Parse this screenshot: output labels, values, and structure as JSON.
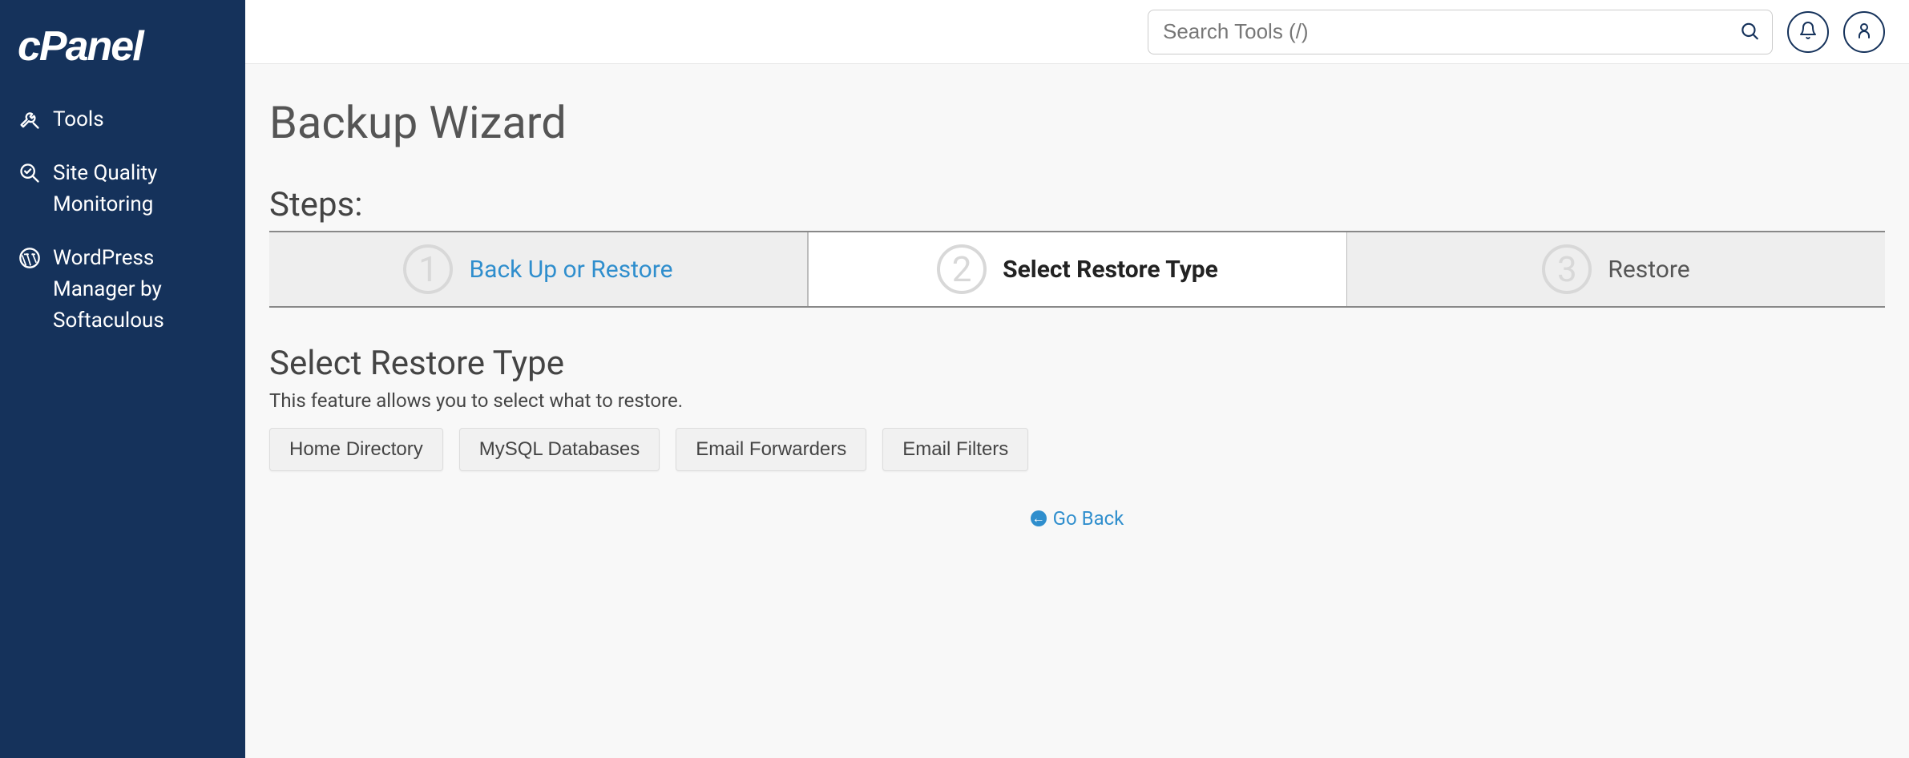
{
  "brand": "cPanel",
  "sidebar": {
    "items": [
      {
        "label": "Tools"
      },
      {
        "label": "Site Quality Monitoring"
      },
      {
        "label": "WordPress Manager by Softaculous"
      }
    ]
  },
  "header": {
    "search_placeholder": "Search Tools (/)"
  },
  "page": {
    "title": "Backup Wizard",
    "steps_heading": "Steps:",
    "steps": [
      {
        "num": "1",
        "label": "Back Up or Restore"
      },
      {
        "num": "2",
        "label": "Select Restore Type"
      },
      {
        "num": "3",
        "label": "Restore"
      }
    ],
    "section_title": "Select Restore Type",
    "description": "This feature allows you to select what to restore.",
    "options": [
      "Home Directory",
      "MySQL Databases",
      "Email Forwarders",
      "Email Filters"
    ],
    "go_back": "Go Back"
  }
}
